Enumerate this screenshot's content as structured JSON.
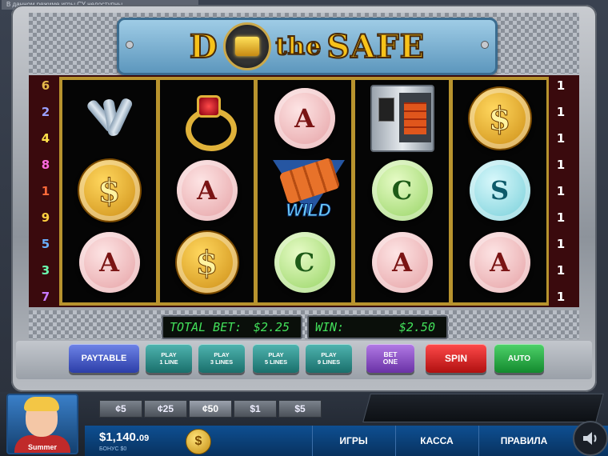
{
  "window": {
    "tab_title": "В данном режиме игры СУ недоступны"
  },
  "logo": {
    "left_word": "D",
    "middle_word": "the",
    "right_word": "SAFE"
  },
  "paylines": {
    "left": [
      {
        "num": "6",
        "color": "#e6b84a"
      },
      {
        "num": "2",
        "color": "#9aa0ff"
      },
      {
        "num": "4",
        "color": "#ffe14a"
      },
      {
        "num": "8",
        "color": "#ff6ae0"
      },
      {
        "num": "1",
        "color": "#ff6a3a"
      },
      {
        "num": "9",
        "color": "#ffd040"
      },
      {
        "num": "5",
        "color": "#6ab0ff"
      },
      {
        "num": "3",
        "color": "#6affb0"
      },
      {
        "num": "7",
        "color": "#c87aff"
      }
    ],
    "right": [
      "1",
      "1",
      "1",
      "1",
      "1",
      "1",
      "1",
      "1",
      "1"
    ]
  },
  "reels": [
    [
      "keys-icon",
      "dollar-coin",
      "A"
    ],
    [
      "ring-icon",
      "A",
      "dollar-coin"
    ],
    [
      "A",
      "WILD",
      "C"
    ],
    [
      "safe-icon",
      "C",
      "A"
    ],
    [
      "dollar-coin",
      "S",
      "A"
    ]
  ],
  "symbols": {
    "wild_label": "WILD",
    "dollar_glyph": "$"
  },
  "displays": {
    "total_bet_label": "TOTAL BET:",
    "total_bet_value": "$2.25",
    "win_label": "WIN:",
    "win_value": "$2.50"
  },
  "buttons": {
    "paytable": "PAYTABLE",
    "play1": [
      "PLAY",
      "1 LINE"
    ],
    "play3": [
      "PLAY",
      "3 LINES"
    ],
    "play5": [
      "PLAY",
      "5 LINES"
    ],
    "play9": [
      "PLAY",
      "9 LINES"
    ],
    "betone": [
      "BET",
      "ONE"
    ],
    "spin": "SPIN",
    "auto": "AUTO"
  },
  "coin_values": [
    {
      "label": "¢5",
      "selected": false
    },
    {
      "label": "¢25",
      "selected": false
    },
    {
      "label": "¢50",
      "selected": true
    },
    {
      "label": "$1",
      "selected": false
    },
    {
      "label": "$5",
      "selected": false
    }
  ],
  "player": {
    "name": "Summer",
    "balance_main": "$1,140.",
    "balance_cents": "09",
    "bonus": "БОНУС $0",
    "coin_glyph": "$"
  },
  "nav": {
    "games": "ИГРЫ",
    "cashier": "КАССА",
    "rules": "ПРАВИЛА"
  },
  "colors": {
    "accent_blue": "#0e4f92",
    "lcd_green": "#42e05a",
    "logo_gold": "#f7c21a"
  }
}
